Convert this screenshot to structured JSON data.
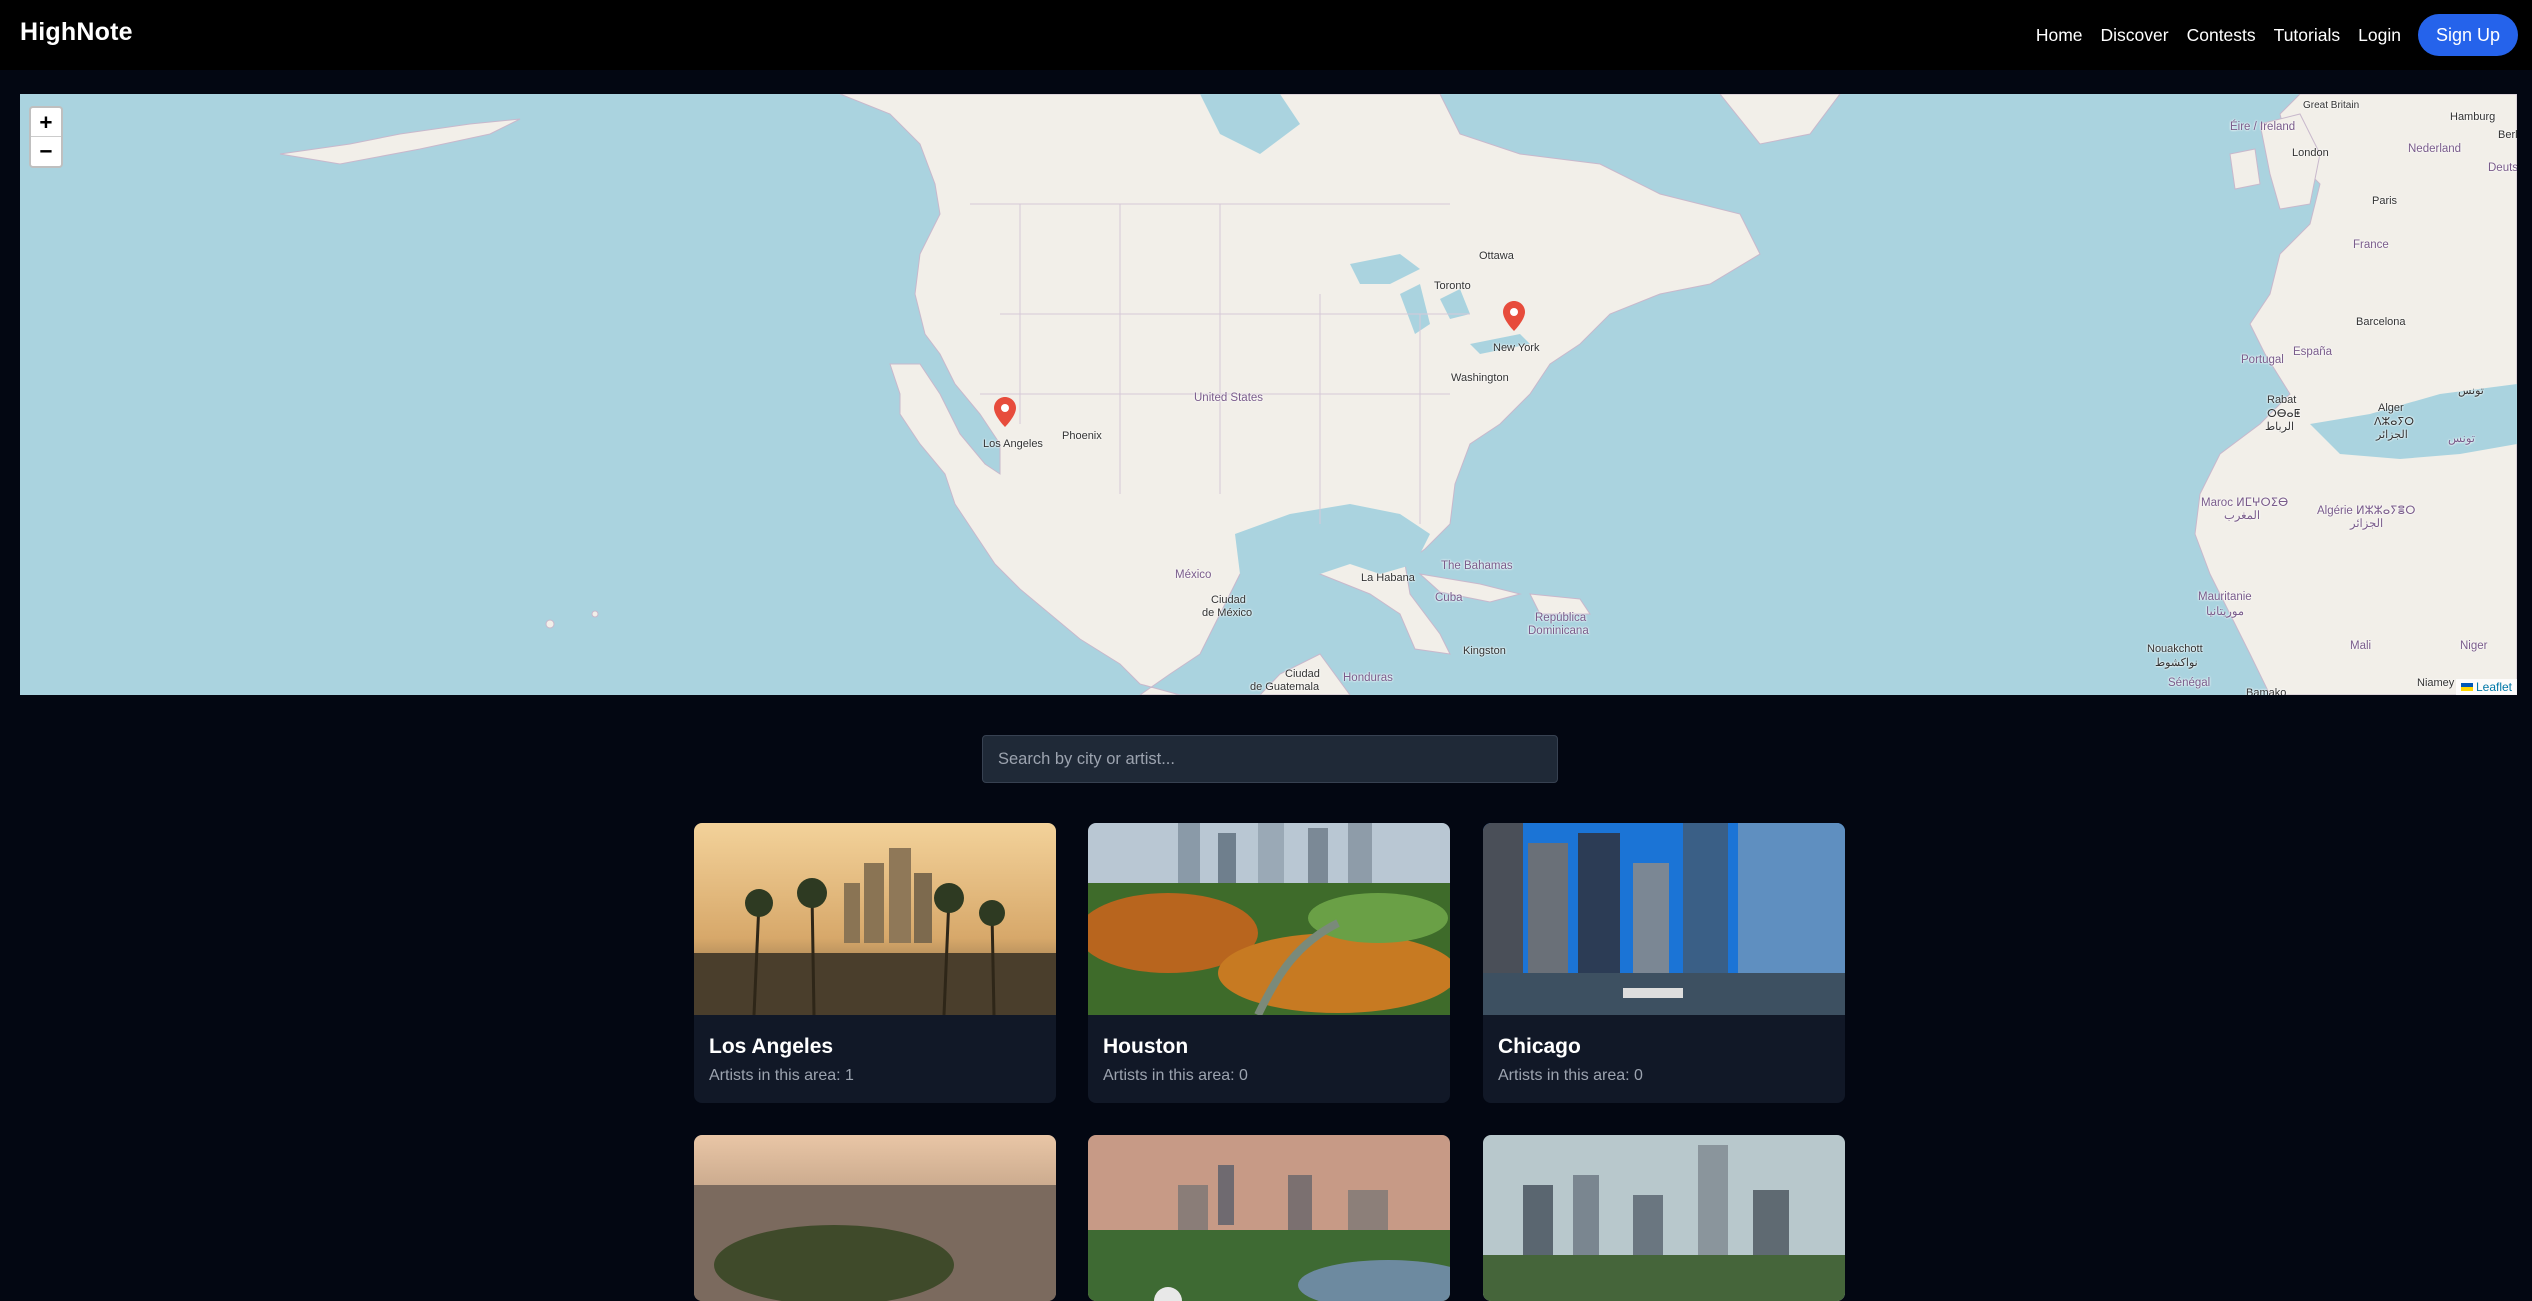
{
  "app": {
    "brand": "HighNote"
  },
  "nav": {
    "links": [
      "Home",
      "Discover",
      "Contests",
      "Tutorials",
      "Login"
    ],
    "signup": "Sign Up"
  },
  "map": {
    "zoom_in": "+",
    "zoom_out": "−",
    "attribution": "Leaflet",
    "markers": [
      "Los Angeles",
      "New York"
    ],
    "labels": {
      "great_britain": "Great Britain",
      "eire": "Éire / Ireland",
      "hamburg": "Hamburg",
      "berlin": "Berl",
      "london": "London",
      "nederland": "Nederland",
      "deutschland": "Deutschland",
      "paris": "Paris",
      "france": "France",
      "barcelona": "Barcelona",
      "espana": "España",
      "portugal": "Portugal",
      "rabat": "Rabat",
      "rabat2": "ⵔⴱⴰⵟ",
      "rabat3": "الرباط",
      "alger": "Alger",
      "alger2": "ⴷⵣⴰⵢⵔ",
      "alger3": "الجزائر",
      "tunis": "تونس",
      "tunisie": "تونس",
      "maroc": "Maroc ⵍⵎⵖⵔⵉⴱ",
      "maroc2": "المغرب",
      "algerie": "Algérie ⵍⵣⵣⴰⵢⴻⵔ",
      "algerie2": "الجزائر",
      "mauritanie": "Mauritanie",
      "mauritanie2": "موريتانيا",
      "mali": "Mali",
      "niger": "Niger",
      "nouakchott": "Nouakchott",
      "nouakchott2": "نواكشوط",
      "niamey": "Niamey",
      "senegal": "Sénégal",
      "bamako": "Bamako",
      "ottawa": "Ottawa",
      "toronto": "Toronto",
      "newyork": "New York",
      "washington": "Washington",
      "united_states": "United States",
      "phoenix": "Phoenix",
      "los_angeles": "Los Angeles",
      "mexico": "México",
      "ciudad_mexico": "Ciudad",
      "ciudad_mexico2": "de México",
      "la_habana": "La Habana",
      "bahamas": "The Bahamas",
      "cuba": "Cuba",
      "republica": "República",
      "dominicana": "Dominicana",
      "kingston": "Kingston",
      "ciudad_guatemala": "Ciudad",
      "guatemala2": "de Guatemala",
      "honduras": "Honduras"
    }
  },
  "search": {
    "placeholder": "Search by city or artist..."
  },
  "cities": [
    {
      "name": "Los Angeles",
      "count": "Artists in this area: 1"
    },
    {
      "name": "Houston",
      "count": "Artists in this area: 0"
    },
    {
      "name": "Chicago",
      "count": "Artists in this area: 0"
    },
    {
      "name": "",
      "count": ""
    },
    {
      "name": "",
      "count": ""
    },
    {
      "name": "",
      "count": ""
    }
  ]
}
